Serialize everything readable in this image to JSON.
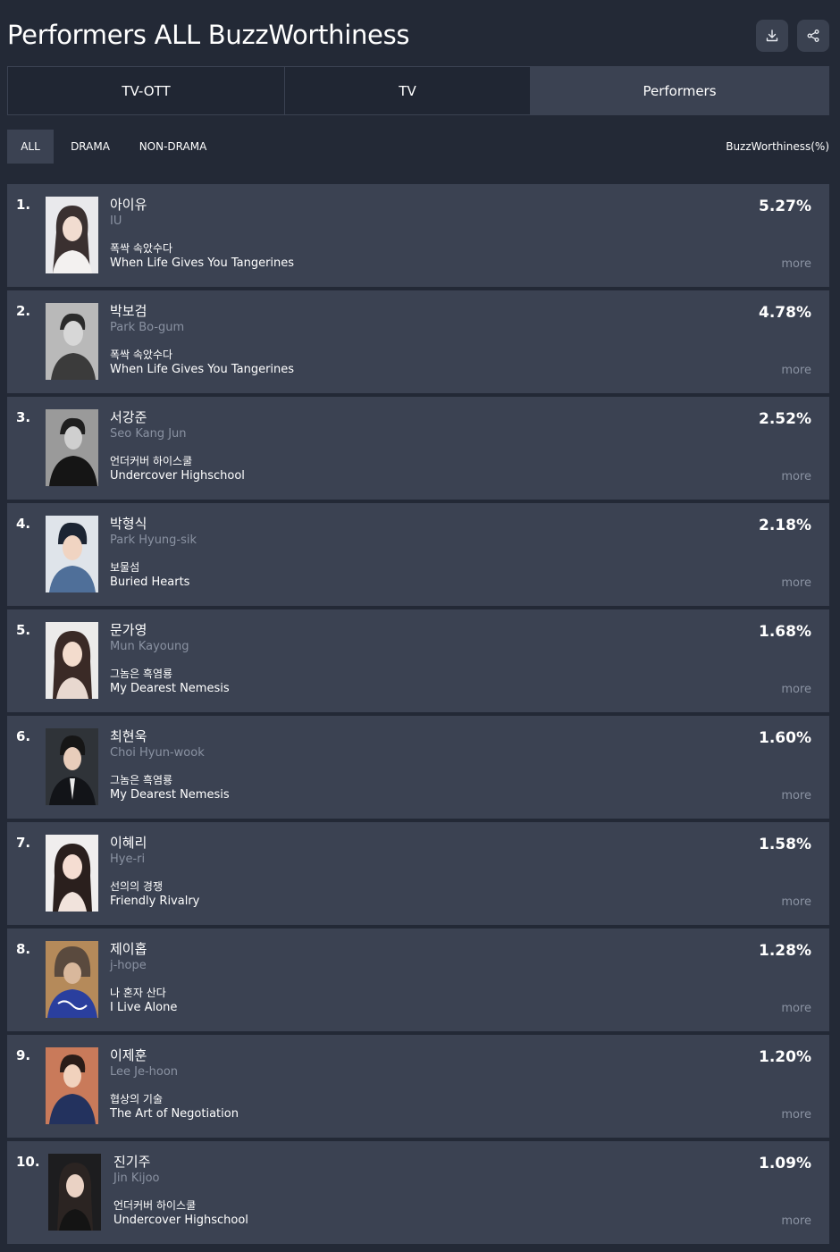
{
  "header": {
    "title": "Performers ALL BuzzWorthiness",
    "download_icon": "download-icon",
    "share_icon": "share-icon"
  },
  "tabs": [
    {
      "label": "TV-OTT",
      "active": false
    },
    {
      "label": "TV",
      "active": false
    },
    {
      "label": "Performers",
      "active": true
    }
  ],
  "filters": [
    {
      "label": "ALL",
      "active": true
    },
    {
      "label": "DRAMA",
      "active": false
    },
    {
      "label": "NON-DRAMA",
      "active": false
    }
  ],
  "metric_label": "BuzzWorthiness(%)",
  "more_label": "more",
  "rows": [
    {
      "rank": "1.",
      "name_ko": "아이유",
      "name_en": "IU",
      "show_ko": "폭싹 속았수다",
      "show_en": "When Life Gives You Tangerines",
      "percent": "5.27%"
    },
    {
      "rank": "2.",
      "name_ko": "박보검",
      "name_en": "Park Bo-gum",
      "show_ko": "폭싹 속았수다",
      "show_en": "When Life Gives You Tangerines",
      "percent": "4.78%"
    },
    {
      "rank": "3.",
      "name_ko": "서강준",
      "name_en": "Seo Kang Jun",
      "show_ko": "언더커버 하이스쿨",
      "show_en": "Undercover Highschool",
      "percent": "2.52%"
    },
    {
      "rank": "4.",
      "name_ko": "박형식",
      "name_en": "Park Hyung-sik",
      "show_ko": "보물섬",
      "show_en": "Buried Hearts",
      "percent": "2.18%"
    },
    {
      "rank": "5.",
      "name_ko": "문가영",
      "name_en": "Mun Kayoung",
      "show_ko": "그놈은 흑염룡",
      "show_en": "My Dearest Nemesis",
      "percent": "1.68%"
    },
    {
      "rank": "6.",
      "name_ko": "최현욱",
      "name_en": "Choi Hyun-wook",
      "show_ko": "그놈은 흑염룡",
      "show_en": "My Dearest Nemesis",
      "percent": "1.60%"
    },
    {
      "rank": "7.",
      "name_ko": "이혜리",
      "name_en": "Hye-ri",
      "show_ko": "선의의 경쟁",
      "show_en": "Friendly Rivalry",
      "percent": "1.58%"
    },
    {
      "rank": "8.",
      "name_ko": "제이홉",
      "name_en": "j-hope",
      "show_ko": "나 혼자 산다",
      "show_en": "I Live Alone",
      "percent": "1.28%"
    },
    {
      "rank": "9.",
      "name_ko": "이제훈",
      "name_en": "Lee Je-hoon",
      "show_ko": "협상의 기술",
      "show_en": "The Art of Negotiation",
      "percent": "1.20%"
    },
    {
      "rank": "10.",
      "name_ko": "진기주",
      "name_en": "Jin Kijoo",
      "show_ko": "언더커버 하이스쿨",
      "show_en": "Undercover Highschool",
      "percent": "1.09%"
    }
  ]
}
